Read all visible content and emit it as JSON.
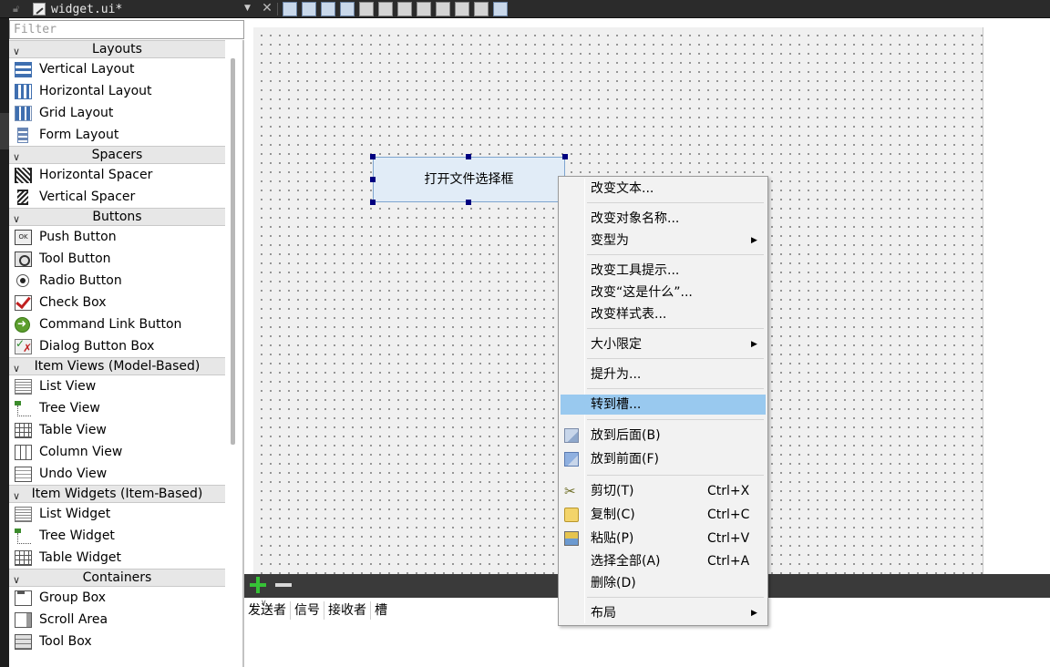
{
  "tab": {
    "title": "widget.ui*"
  },
  "filter": {
    "placeholder": "Filter"
  },
  "widget_box": [
    {
      "category": "Layouts",
      "items": [
        {
          "label": "Vertical Layout",
          "icon": "vertical-layout-icon"
        },
        {
          "label": "Horizontal Layout",
          "icon": "horizontal-layout-icon"
        },
        {
          "label": "Grid Layout",
          "icon": "grid-layout-icon"
        },
        {
          "label": "Form Layout",
          "icon": "form-layout-icon"
        }
      ]
    },
    {
      "category": "Spacers",
      "items": [
        {
          "label": "Horizontal Spacer",
          "icon": "horizontal-spacer-icon"
        },
        {
          "label": "Vertical Spacer",
          "icon": "vertical-spacer-icon"
        }
      ]
    },
    {
      "category": "Buttons",
      "items": [
        {
          "label": "Push Button",
          "icon": "push-button-icon"
        },
        {
          "label": "Tool Button",
          "icon": "tool-button-icon"
        },
        {
          "label": "Radio Button",
          "icon": "radio-button-icon"
        },
        {
          "label": "Check Box",
          "icon": "check-box-icon"
        },
        {
          "label": "Command Link Button",
          "icon": "command-link-icon"
        },
        {
          "label": "Dialog Button Box",
          "icon": "dialog-button-box-icon"
        }
      ]
    },
    {
      "category": "Item Views (Model-Based)",
      "items": [
        {
          "label": "List View",
          "icon": "list-view-icon"
        },
        {
          "label": "Tree View",
          "icon": "tree-view-icon"
        },
        {
          "label": "Table View",
          "icon": "table-view-icon"
        },
        {
          "label": "Column View",
          "icon": "column-view-icon"
        },
        {
          "label": "Undo View",
          "icon": "undo-view-icon"
        }
      ]
    },
    {
      "category": "Item Widgets (Item-Based)",
      "items": [
        {
          "label": "List Widget",
          "icon": "list-widget-icon"
        },
        {
          "label": "Tree Widget",
          "icon": "tree-widget-icon"
        },
        {
          "label": "Table Widget",
          "icon": "table-widget-icon"
        }
      ]
    },
    {
      "category": "Containers",
      "items": [
        {
          "label": "Group Box",
          "icon": "group-box-icon"
        },
        {
          "label": "Scroll Area",
          "icon": "scroll-area-icon"
        },
        {
          "label": "Tool Box",
          "icon": "tool-box-icon"
        }
      ]
    }
  ],
  "form": {
    "button_text": "打开文件选择框"
  },
  "context_menu": [
    {
      "label": "改变文本...",
      "shortcut": "",
      "submenu": false,
      "highlighted": false,
      "icon": ""
    },
    {
      "label": "改变对象名称...",
      "shortcut": "",
      "submenu": false,
      "highlighted": false,
      "icon": ""
    },
    {
      "label": "变型为",
      "shortcut": "",
      "submenu": true,
      "highlighted": false,
      "icon": ""
    },
    {
      "label": "改变工具提示...",
      "shortcut": "",
      "submenu": false,
      "highlighted": false,
      "icon": ""
    },
    {
      "label": "改变“这是什么”...",
      "shortcut": "",
      "submenu": false,
      "highlighted": false,
      "icon": ""
    },
    {
      "label": "改变样式表...",
      "shortcut": "",
      "submenu": false,
      "highlighted": false,
      "icon": ""
    },
    {
      "label": "大小限定",
      "shortcut": "",
      "submenu": true,
      "highlighted": false,
      "icon": ""
    },
    {
      "label": "提升为...",
      "shortcut": "",
      "submenu": false,
      "highlighted": false,
      "icon": ""
    },
    {
      "label": "转到槽...",
      "shortcut": "",
      "submenu": false,
      "highlighted": true,
      "icon": ""
    },
    {
      "label": "放到后面(B)",
      "shortcut": "",
      "submenu": false,
      "highlighted": false,
      "icon": "send-to-back-icon"
    },
    {
      "label": "放到前面(F)",
      "shortcut": "",
      "submenu": false,
      "highlighted": false,
      "icon": "bring-to-front-icon"
    },
    {
      "label": "剪切(T)",
      "shortcut": "Ctrl+X",
      "submenu": false,
      "highlighted": false,
      "icon": "cut-icon"
    },
    {
      "label": "复制(C)",
      "shortcut": "Ctrl+C",
      "submenu": false,
      "highlighted": false,
      "icon": "copy-icon"
    },
    {
      "label": "粘贴(P)",
      "shortcut": "Ctrl+V",
      "submenu": false,
      "highlighted": false,
      "icon": "paste-icon"
    },
    {
      "label": "选择全部(A)",
      "shortcut": "Ctrl+A",
      "submenu": false,
      "highlighted": false,
      "icon": ""
    },
    {
      "label": "删除(D)",
      "shortcut": "",
      "submenu": false,
      "highlighted": false,
      "icon": ""
    },
    {
      "label": "布局",
      "shortcut": "",
      "submenu": true,
      "highlighted": false,
      "icon": ""
    }
  ],
  "signal_slot_editor": {
    "columns": [
      "发送者",
      "信号",
      "接收者",
      "槽"
    ]
  }
}
